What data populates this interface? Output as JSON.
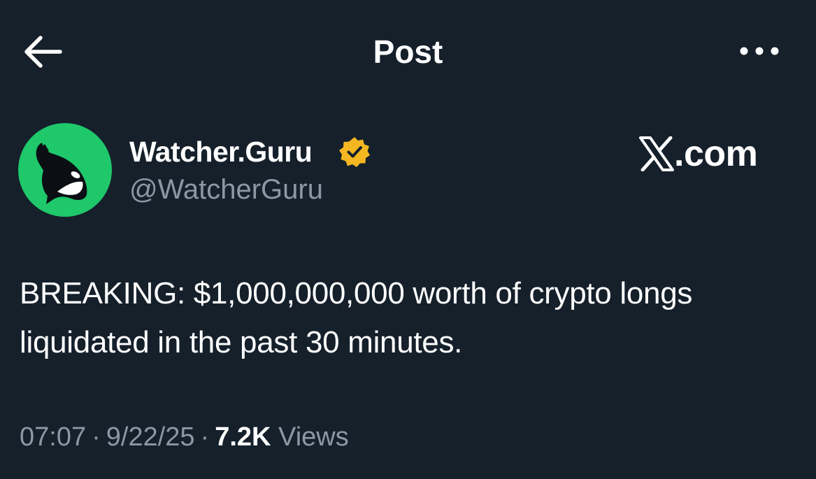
{
  "header": {
    "title": "Post",
    "back_icon": "arrow-left-icon",
    "more_icon": "more-horizontal-icon"
  },
  "author": {
    "display_name": "Watcher.Guru",
    "handle": "@WatcherGuru",
    "verified": true,
    "verified_color": "#f4b721",
    "avatar_icon": "whale-icon",
    "avatar_color": "#1fc86b"
  },
  "watermark": {
    "logo_icon": "x-logo-icon",
    "text": ".com"
  },
  "post": {
    "text": "BREAKING: $1,000,000,000 worth of crypto longs liquidated in the past 30 minutes."
  },
  "meta": {
    "time": "07:07",
    "date": "9/22/25",
    "views_count": "7.2K",
    "views_label": "Views",
    "separator": "·"
  },
  "colors": {
    "background": "#15202b",
    "primary_text": "#ffffff",
    "secondary_text": "#8b98a5"
  }
}
